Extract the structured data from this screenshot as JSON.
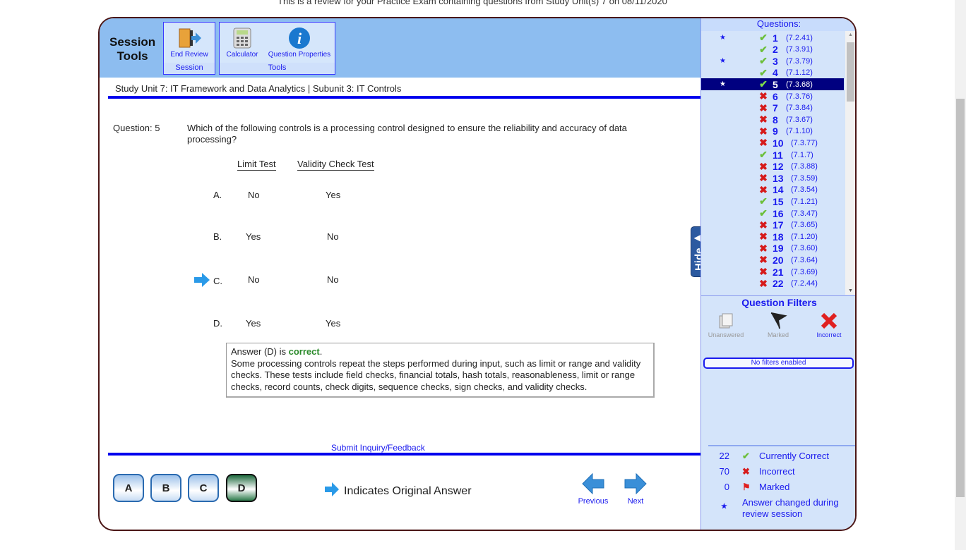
{
  "banner": "This is a review for your Practice Exam containing questions from Study Unit(s) 7 on 08/11/2020",
  "toolbar": {
    "title_line1": "Session",
    "title_line2": "Tools",
    "session_group": "Session",
    "tools_group": "Tools",
    "end_review": "End Review",
    "calculator": "Calculator",
    "question_properties": "Question Properties"
  },
  "breadcrumb": "Study Unit 7: IT Framework and Data Analytics | Subunit 3: IT Controls",
  "question": {
    "label": "Question: 5",
    "text": "Which of the following controls is a processing control designed to ensure the reliability and accuracy of data processing?",
    "columns": [
      "Limit Test",
      "Validity Check Test"
    ],
    "options": [
      {
        "letter": "A.",
        "c1": "No",
        "c2": "Yes"
      },
      {
        "letter": "B.",
        "c1": "Yes",
        "c2": "No"
      },
      {
        "letter": "C.",
        "c1": "No",
        "c2": "No",
        "original": true
      },
      {
        "letter": "D.",
        "c1": "Yes",
        "c2": "Yes"
      }
    ],
    "answer_prefix": "Answer (D) is ",
    "answer_status": "correct",
    "answer_suffix": ".",
    "explanation": "Some processing controls repeat the steps performed during input, such as limit or range and validity checks. These tests include field checks, financial totals, hash totals, reasonableness, limit or range checks, record counts, check digits, sequence checks, sign checks, and validity checks."
  },
  "submit_inquiry": "Submit Inquiry/Feedback",
  "answer_buttons": [
    "A",
    "B",
    "C",
    "D"
  ],
  "selected_answer": "D",
  "original_answer_legend": "Indicates Original Answer",
  "nav": {
    "previous": "Previous",
    "next": "Next"
  },
  "sidebar": {
    "title": "Questions:",
    "hide": "Hide",
    "current": 5,
    "questions": [
      {
        "n": "1",
        "ref": "(7.2.41)",
        "s": "correct",
        "star": true
      },
      {
        "n": "2",
        "ref": "(7.3.91)",
        "s": "correct"
      },
      {
        "n": "3",
        "ref": "(7.3.79)",
        "s": "correct",
        "star": true
      },
      {
        "n": "4",
        "ref": "(7.1.12)",
        "s": "correct"
      },
      {
        "n": "5",
        "ref": "(7.3.68)",
        "s": "correct",
        "star": true
      },
      {
        "n": "6",
        "ref": "(7.3.76)",
        "s": "incorrect"
      },
      {
        "n": "7",
        "ref": "(7.3.84)",
        "s": "incorrect"
      },
      {
        "n": "8",
        "ref": "(7.3.67)",
        "s": "incorrect"
      },
      {
        "n": "9",
        "ref": "(7.1.10)",
        "s": "incorrect"
      },
      {
        "n": "10",
        "ref": "(7.3.77)",
        "s": "incorrect"
      },
      {
        "n": "11",
        "ref": "(7.1.7)",
        "s": "correct"
      },
      {
        "n": "12",
        "ref": "(7.3.88)",
        "s": "incorrect"
      },
      {
        "n": "13",
        "ref": "(7.3.59)",
        "s": "incorrect"
      },
      {
        "n": "14",
        "ref": "(7.3.54)",
        "s": "incorrect"
      },
      {
        "n": "15",
        "ref": "(7.1.21)",
        "s": "correct"
      },
      {
        "n": "16",
        "ref": "(7.3.47)",
        "s": "correct"
      },
      {
        "n": "17",
        "ref": "(7.3.65)",
        "s": "incorrect"
      },
      {
        "n": "18",
        "ref": "(7.1.20)",
        "s": "incorrect"
      },
      {
        "n": "19",
        "ref": "(7.3.60)",
        "s": "incorrect"
      },
      {
        "n": "20",
        "ref": "(7.3.64)",
        "s": "incorrect"
      },
      {
        "n": "21",
        "ref": "(7.3.69)",
        "s": "incorrect"
      },
      {
        "n": "22",
        "ref": "(7.2.44)",
        "s": "incorrect"
      }
    ],
    "filters_title": "Question Filters",
    "filters": [
      {
        "label": "Unanswered",
        "enabled": false
      },
      {
        "label": "Marked",
        "enabled": false
      },
      {
        "label": "Incorrect",
        "enabled": true
      }
    ],
    "filter_status": "No filters enabled",
    "legend": [
      {
        "count": "22",
        "label": "Currently Correct",
        "icon": "check-icon"
      },
      {
        "count": "70",
        "label": "Incorrect",
        "icon": "x-icon"
      },
      {
        "count": "0",
        "label": "Marked",
        "icon": "flag-icon"
      },
      {
        "count": "",
        "label": "Answer changed during review session",
        "icon": "star-icon"
      }
    ]
  },
  "colors": {
    "header": "#8dbdf0",
    "sidebar": "#d4e4fa",
    "link": "#1a1aee",
    "correct": "#2a8a2a",
    "current_row": "#000080"
  }
}
